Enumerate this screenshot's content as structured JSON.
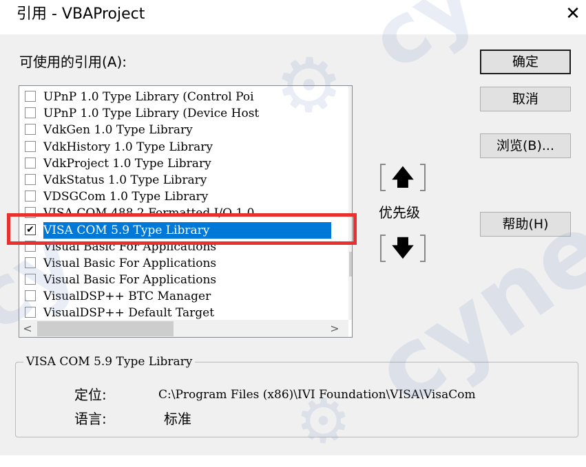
{
  "window": {
    "title": "引用 - VBAProject",
    "close_glyph": "✕"
  },
  "available_label": "可使用的引用(A):",
  "references": [
    {
      "label": "UPnP 1.0 Type Library (Control Poi",
      "checked": false
    },
    {
      "label": "UPnP 1.0 Type Library (Device Host",
      "checked": false
    },
    {
      "label": "VdkGen 1.0 Type Library",
      "checked": false
    },
    {
      "label": "VdkHistory 1.0 Type Library",
      "checked": false
    },
    {
      "label": "VdkProject 1.0 Type Library",
      "checked": false
    },
    {
      "label": "VdkStatus 1.0 Type Library",
      "checked": false
    },
    {
      "label": "VDSGCom 1.0 Type Library",
      "checked": false
    },
    {
      "label": "VISA COM 488.2 Formatted I/O 1.0",
      "checked": false
    },
    {
      "label": "VISA COM 5.9 Type Library",
      "checked": true,
      "selected": true
    },
    {
      "label": "Visual Basic For Applications",
      "checked": false
    },
    {
      "label": "Visual Basic For Applications",
      "checked": false
    },
    {
      "label": "Visual Basic For Applications",
      "checked": false
    },
    {
      "label": "VisualDSP++ BTC Manager",
      "checked": false
    },
    {
      "label": "VisualDSP++ Default Target",
      "checked": false
    }
  ],
  "check_glyph": "✔",
  "scroll": {
    "up": "︿",
    "down": "﹀",
    "left": "<",
    "right": ">"
  },
  "buttons": {
    "ok": "确定",
    "cancel": "取消",
    "browse": "浏览(B)...",
    "help": "帮助(H)"
  },
  "priority": {
    "label": "优先级",
    "up_glyph": "🡅",
    "down_glyph": "🡇"
  },
  "details": {
    "group_title": "VISA COM 5.9 Type Library",
    "location_label": "定位:",
    "location_value": "C:\\Program Files (x86)\\IVI Foundation\\VISA\\VisaCom",
    "language_label": "语言:",
    "language_value": "标准"
  },
  "watermark": {
    "text_a": "cynep",
    "text_b": "cy",
    "logo_glyph": "⚙"
  },
  "colors": {
    "selection": "#0078d7",
    "highlight_box": "#e8302f"
  }
}
